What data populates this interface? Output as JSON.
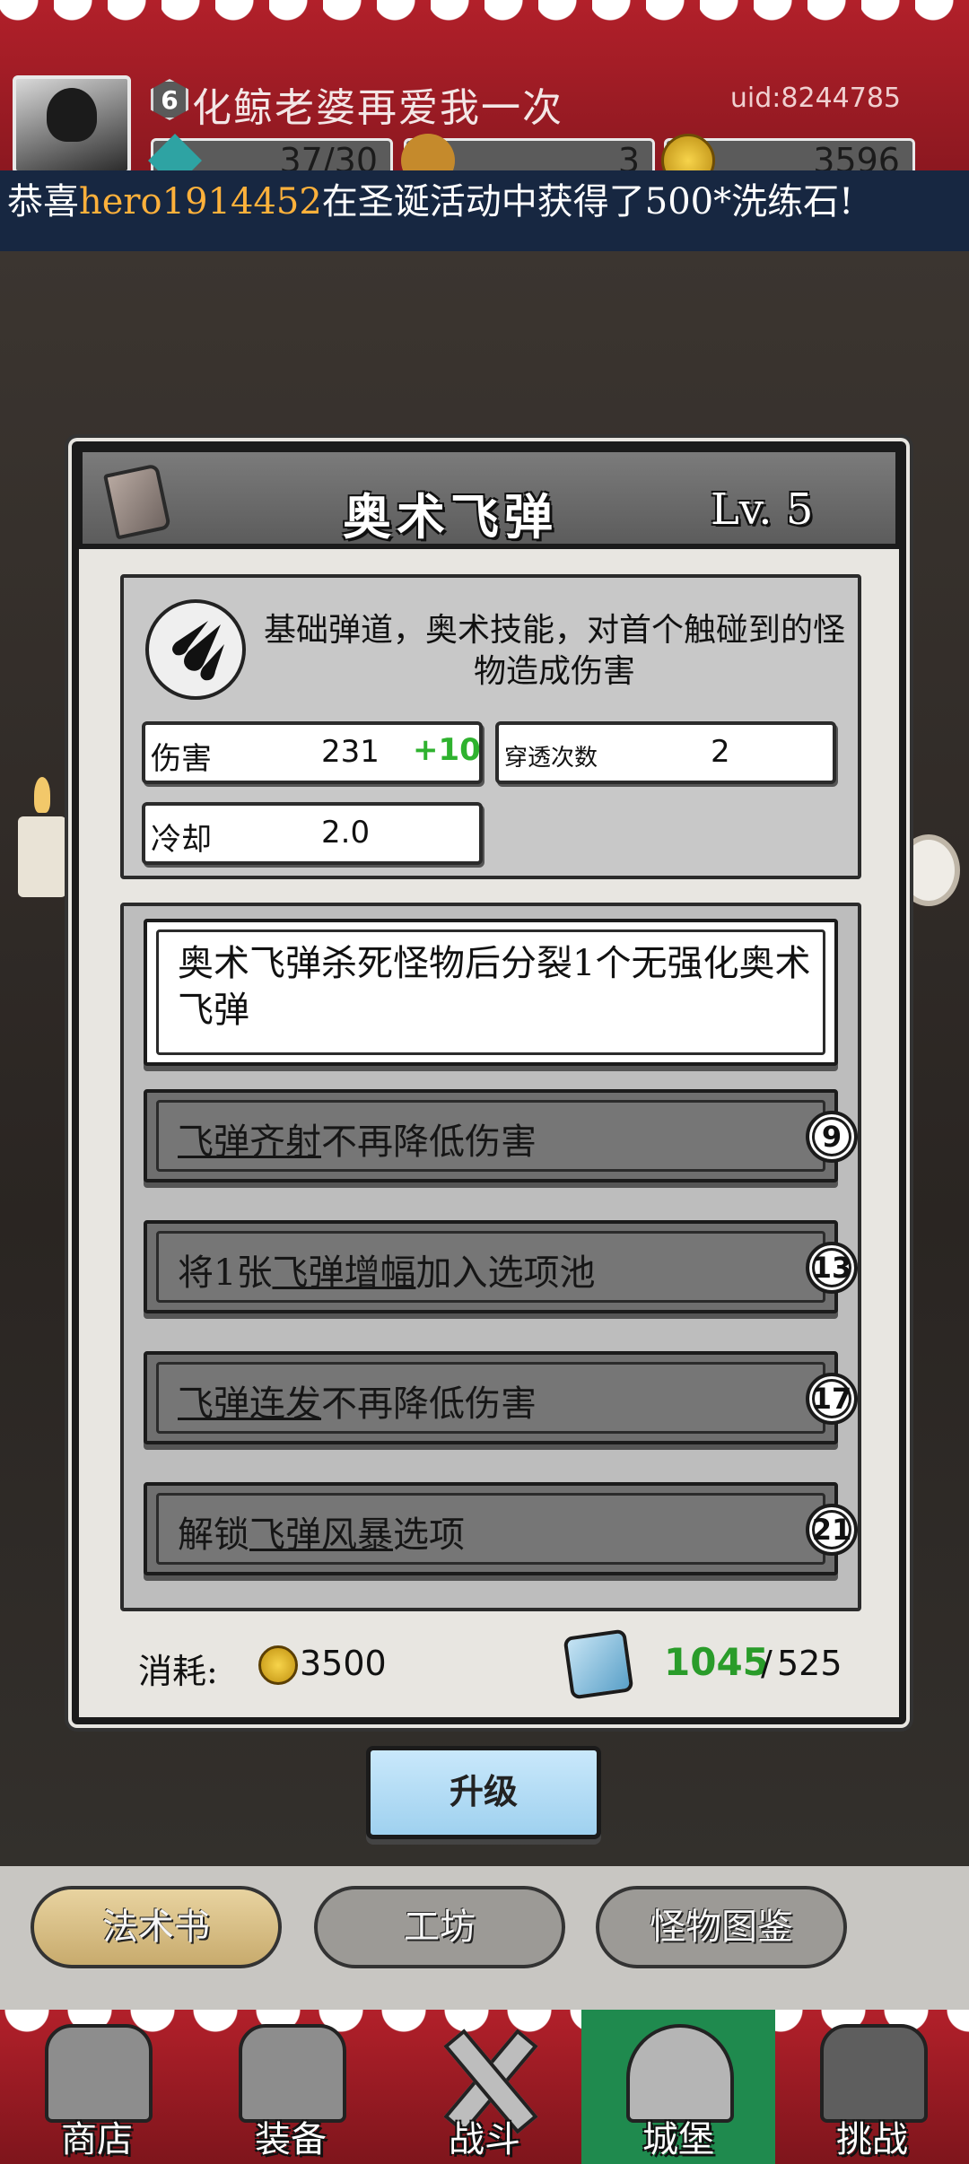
{
  "header": {
    "player_level": "6",
    "player_name": "化鲸老婆再爱我一次",
    "uid": "uid:8244785",
    "resources": {
      "energy": "37/30",
      "item": "3",
      "gold": "3596"
    }
  },
  "marquee": {
    "prefix": "恭喜",
    "player": "hero1914452",
    "message": "在圣诞活动中获得了500*洗练石!"
  },
  "skill": {
    "name": "奥术飞弹",
    "level": "Lv. 5",
    "description": "基础弹道，奥术技能，对首个触碰到的怪物造成伤害",
    "stats": {
      "damage_label": "伤害",
      "damage_value": "231",
      "damage_bonus": "+10",
      "pierce_label": "穿透次数",
      "pierce_value": "2",
      "cooldown_label": "冷却",
      "cooldown_value": "2.0"
    }
  },
  "upgrades": {
    "active": "奥术飞弹杀死怪物后分裂1个无强化奥术飞弹",
    "nodes": [
      {
        "pre": "",
        "link": "飞弹齐射",
        "post": "不再降低伤害",
        "level": "9"
      },
      {
        "pre": "将1张",
        "link": "飞弹增幅",
        "post": "加入选项池",
        "level": "13"
      },
      {
        "pre": "",
        "link": "飞弹连发",
        "post": "不再降低伤害",
        "level": "17"
      },
      {
        "pre": "解锁",
        "link": "飞弹风暴",
        "post": "选项",
        "level": "21"
      }
    ]
  },
  "cost": {
    "label": "消耗:",
    "gold": "3500",
    "gem_have": "1045",
    "gem_sep": "/",
    "gem_need": "525"
  },
  "upgrade_button": "升级",
  "tabs": [
    "法术书",
    "工坊",
    "怪物图鉴"
  ],
  "nav": [
    "商店",
    "装备",
    "战斗",
    "城堡",
    "挑战"
  ],
  "colors": {
    "header_red": "#b2202a",
    "bonus_green": "#2fb22f",
    "gem_have_green": "#2a9c2a",
    "highlight_orange": "#ffb13b",
    "upgrade_button_blue": "#b4dcf5",
    "selected_tab_gold": "#d8bf86",
    "selected_nav_green": "#1f8a4e"
  }
}
